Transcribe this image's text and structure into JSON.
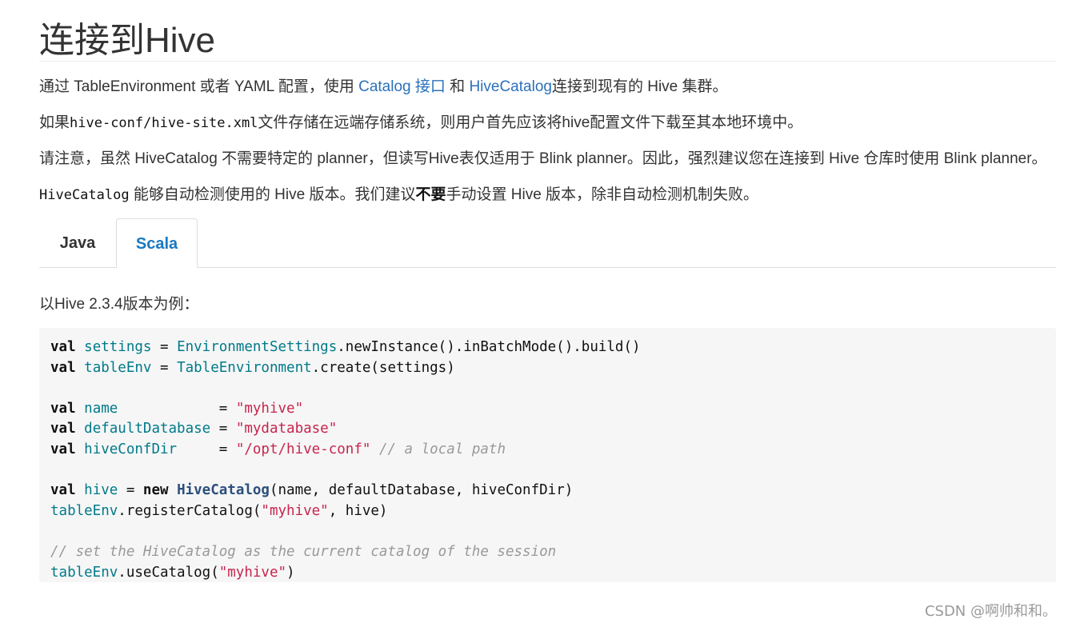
{
  "page": {
    "title": "连接到Hive",
    "p1": {
      "a": "通过 TableEnvironment 或者 YAML 配置，使用 ",
      "link1": "Catalog 接口",
      "b": " 和 ",
      "link2": "HiveCatalog",
      "c": "连接到现有的 Hive 集群。"
    },
    "p2": {
      "a": "如果",
      "code": "hive-conf/hive-site.xml",
      "b": "文件存储在远端存储系统，则用户首先应该将hive配置文件下载至其本地环境中。"
    },
    "p3": "请注意，虽然 HiveCatalog 不需要特定的 planner，但读写Hive表仅适用于 Blink planner。因此，强烈建议您在连接到 Hive 仓库时使用 Blink planner。",
    "p4": {
      "code": "HiveCatalog",
      "a": " 能够自动检测使用的 Hive 版本。我们建议",
      "strong": "不要",
      "b": "手动设置 Hive 版本，除非自动检测机制失败。"
    },
    "tabs": [
      {
        "label": "Java",
        "active": false
      },
      {
        "label": "Scala",
        "active": true
      }
    ],
    "p5": "以Hive 2.3.4版本为例：",
    "code": {
      "val": "val",
      "new": "new",
      "settings": "settings",
      "envSettings": "EnvironmentSettings",
      "l1rest": ".newInstance().inBatchMode().build()",
      "tableEnv": "tableEnv",
      "tableEnvironment": "TableEnvironment",
      "l2rest": ".create(settings)",
      "name": "name",
      "nameStr": "\"myhive\"",
      "defaultDatabase": "defaultDatabase",
      "dbStr": "\"mydatabase\"",
      "hiveConfDir": "hiveConfDir",
      "confStr": "\"/opt/hive-conf\"",
      "confCmt": "// a local path",
      "hive": "hive",
      "hiveCatalog": "HiveCatalog",
      "l7rest": "(name, defaultDatabase, hiveConfDir)",
      "registerCall": ".registerCatalog(",
      "myhiveStr": "\"myhive\"",
      "registerRest": ", hive)",
      "sessionCmt": "// set the HiveCatalog as the current catalog of the session",
      "useCall": ".useCatalog(",
      "useRest": ")"
    },
    "watermark": "CSDN @啊帅和和。"
  }
}
